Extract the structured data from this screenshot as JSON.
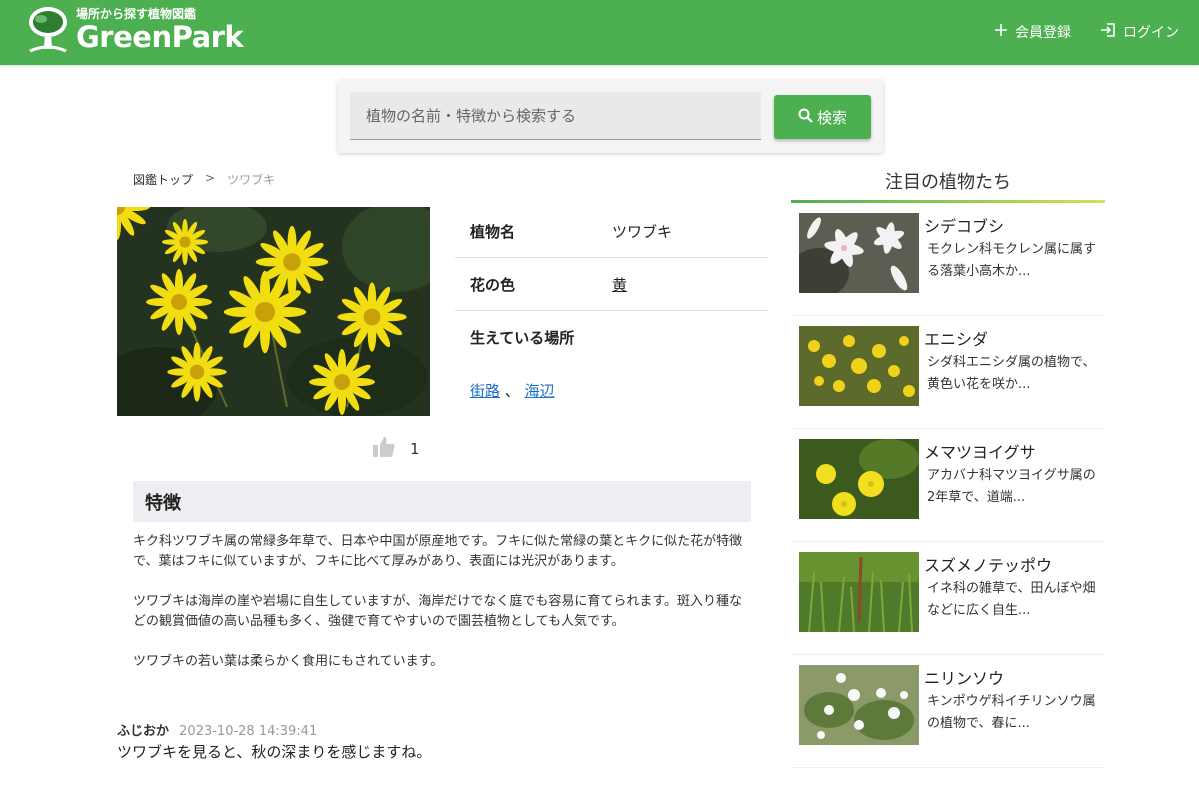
{
  "header": {
    "tagline": "場所から探す植物図鑑",
    "brand": "GreenPark",
    "nav": {
      "register": "会員登録",
      "login": "ログイン"
    }
  },
  "search": {
    "placeholder": "植物の名前・特徴から検索する",
    "button": "検索"
  },
  "breadcrumb": {
    "top": "図鑑トップ",
    "separator": ">",
    "current": "ツワブキ"
  },
  "plant": {
    "name_label": "植物名",
    "name": "ツワブキ",
    "color_label": "花の色",
    "color": "黄",
    "place_label": "生えている場所",
    "places": [
      "街路",
      "海辺"
    ],
    "place_separator": "、",
    "likes": "1"
  },
  "features": {
    "heading": "特徴",
    "paragraphs": [
      "キク科ツワブキ属の常緑多年草で、日本や中国が原産地です。フキに似た常緑の葉とキクに似た花が特徴で、葉はフキに似ていますが、フキに比べて厚みがあり、表面には光沢があります。",
      "ツワブキは海岸の崖や岩場に自生していますが、海岸だけでなく庭でも容易に育てられます。斑入り種などの観賞価値の高い品種も多く、強健で育てやすいので園芸植物としても人気です。",
      "ツワブキの若い葉は柔らかく食用にもされています。"
    ]
  },
  "comment": {
    "author": "ふじおか",
    "time": "2023-10-28 14:39:41",
    "text": "ツワブキを見ると、秋の深まりを感じますね。"
  },
  "sidebar": {
    "title": "注目の植物たち",
    "items": [
      {
        "name": "シデコブシ",
        "desc": "モクレン科モクレン属に属する落葉小高木か..."
      },
      {
        "name": "エニシダ",
        "desc": "シダ科エニシダ属の植物で、黄色い花を咲か..."
      },
      {
        "name": "メマツヨイグサ",
        "desc": "アカバナ科マツヨイグサ属の2年草で、道端..."
      },
      {
        "name": "スズメノテッポウ",
        "desc": "イネ科の雑草で、田んぼや畑などに広く自生..."
      },
      {
        "name": "ニリンソウ",
        "desc": "キンポウゲ科イチリンソウ属の植物で、春に..."
      }
    ]
  },
  "colors": {
    "brand_green": "#4caf50",
    "link_blue": "#1a6fc4"
  }
}
